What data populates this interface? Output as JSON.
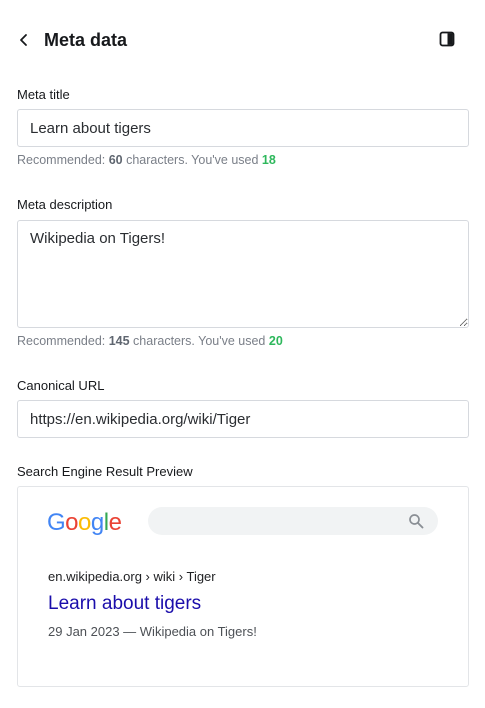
{
  "header": {
    "title": "Meta data",
    "back_icon": "chevron-left-icon",
    "panel_icon": "sidebar-toggle-icon"
  },
  "meta_title": {
    "label": "Meta title",
    "value": "Learn about tigers",
    "hint_prefix": "Recommended: ",
    "recommended": "60",
    "hint_middle": " characters. You've used ",
    "used": "18"
  },
  "meta_description": {
    "label": "Meta description",
    "value": "Wikipedia on Tigers!",
    "hint_prefix": "Recommended: ",
    "recommended": "145",
    "hint_middle": " characters. You've used ",
    "used": "20"
  },
  "canonical_url": {
    "label": "Canonical URL",
    "value": "https://en.wikipedia.org/wiki/Tiger"
  },
  "preview": {
    "label": "Search Engine Result Preview",
    "logo_letters": [
      "G",
      "o",
      "o",
      "g",
      "l",
      "e"
    ],
    "logo_colors": [
      "#4285F4",
      "#EA4335",
      "#FBBC05",
      "#4285F4",
      "#34A853",
      "#EA4335"
    ],
    "search_icon": "search-icon",
    "url": "en.wikipedia.org › wiki › Tiger",
    "title": "Learn about tigers",
    "snippet": "29 Jan 2023 — Wikipedia on Tigers!"
  },
  "colors": {
    "used_count": "#2eb85c",
    "serp_title": "#1a0dab"
  }
}
